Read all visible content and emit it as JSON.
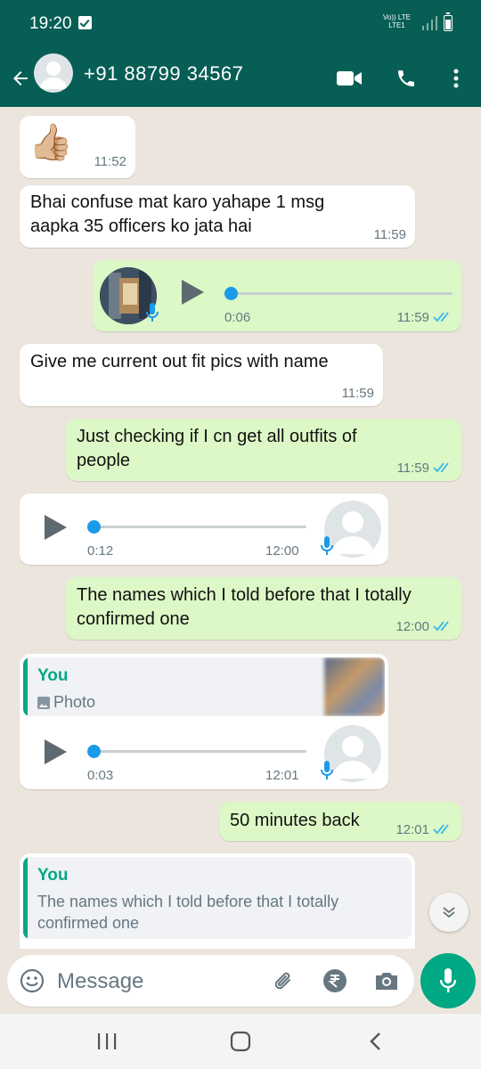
{
  "status_bar": {
    "time": "19:20",
    "network_top": "Vo)) LTE",
    "network_bottom": "LTE1"
  },
  "header": {
    "contact": "+91 88799 34567"
  },
  "messages": [
    {
      "type": "sticker",
      "direction": "in",
      "emoji": "👍🏼",
      "time": "11:52"
    },
    {
      "type": "text",
      "direction": "in",
      "text": "Bhai confuse mat karo yahape 1 msg aapka 35 officers ko jata hai",
      "time": "11:59"
    },
    {
      "type": "voice",
      "direction": "out",
      "duration": "0:06",
      "time": "11:59",
      "status": "read"
    },
    {
      "type": "text",
      "direction": "in",
      "text": "Give me current out fit pics with name",
      "time": "11:59"
    },
    {
      "type": "text",
      "direction": "out",
      "text": "Just checking if I cn get all outfits of people",
      "time": "11:59",
      "status": "read"
    },
    {
      "type": "voice",
      "direction": "in",
      "duration": "0:12",
      "time": "12:00"
    },
    {
      "type": "text",
      "direction": "out",
      "text": "The names which I told before that I totally confirmed one",
      "time": "12:00",
      "status": "read"
    },
    {
      "type": "voice_reply",
      "direction": "in",
      "quote_author": "You",
      "quote_text": "Photo",
      "duration": "0:03",
      "time": "12:01"
    },
    {
      "type": "text",
      "direction": "out",
      "text": "50 minutes back",
      "time": "12:01",
      "status": "read"
    },
    {
      "type": "reply",
      "direction": "in",
      "quote_author": "You",
      "quote_text": "The names which I told before that I totally confirmed one"
    }
  ],
  "input": {
    "placeholder": "Message"
  },
  "icons": [
    "back-arrow-icon",
    "video-call-icon",
    "phone-icon",
    "more-vert-icon",
    "emoji-icon",
    "attach-icon",
    "rupee-icon",
    "camera-icon",
    "mic-icon",
    "chevron-double-down-icon"
  ],
  "colors": {
    "header": "#075e54",
    "outgoing_bubble": "#dcf8c6",
    "incoming_bubble": "#ffffff",
    "accent": "#00a884",
    "read_tick": "#34b7f1",
    "chat_bg": "#ece5dd"
  }
}
